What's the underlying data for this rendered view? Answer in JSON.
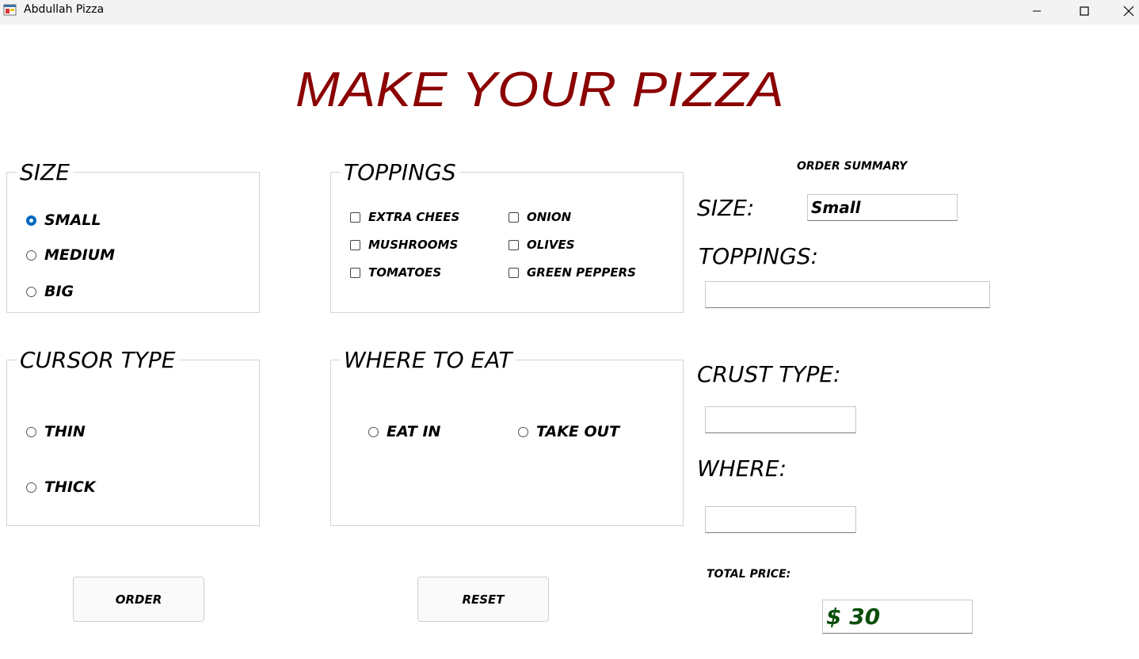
{
  "window": {
    "title": "Abdullah Pizza"
  },
  "heading": "MAKE YOUR PIZZA",
  "size_group": {
    "legend": "SIZE",
    "options": [
      {
        "label": "SMALL",
        "checked": true
      },
      {
        "label": "MEDIUM",
        "checked": false
      },
      {
        "label": "BIG",
        "checked": false
      }
    ]
  },
  "toppings_group": {
    "legend": "TOPPINGS",
    "options": [
      {
        "label": "EXTRA CHEES",
        "checked": false
      },
      {
        "label": "MUSHROOMS",
        "checked": false
      },
      {
        "label": "TOMATOES",
        "checked": false
      },
      {
        "label": "ONION",
        "checked": false
      },
      {
        "label": "OLIVES",
        "checked": false
      },
      {
        "label": "GREEN PEPPERS",
        "checked": false
      }
    ]
  },
  "crust_group": {
    "legend": "CURSOR TYPE",
    "options": [
      {
        "label": "THIN",
        "checked": false
      },
      {
        "label": "THICK",
        "checked": false
      }
    ]
  },
  "where_group": {
    "legend": "WHERE TO EAT",
    "options": [
      {
        "label": "EAT IN",
        "checked": false
      },
      {
        "label": "TAKE OUT",
        "checked": false
      }
    ]
  },
  "summary": {
    "title": "ORDER SUMMARY",
    "size_label": "SIZE:",
    "size_value": "Small",
    "toppings_label": "TOPPINGS:",
    "toppings_value": "",
    "crust_label": "CRUST TYPE:",
    "crust_value": "",
    "where_label": "WHERE:",
    "where_value": "",
    "total_label": "TOTAL PRICE:",
    "total_value": "$ 30"
  },
  "buttons": {
    "order": "ORDER",
    "reset": "RESET"
  }
}
